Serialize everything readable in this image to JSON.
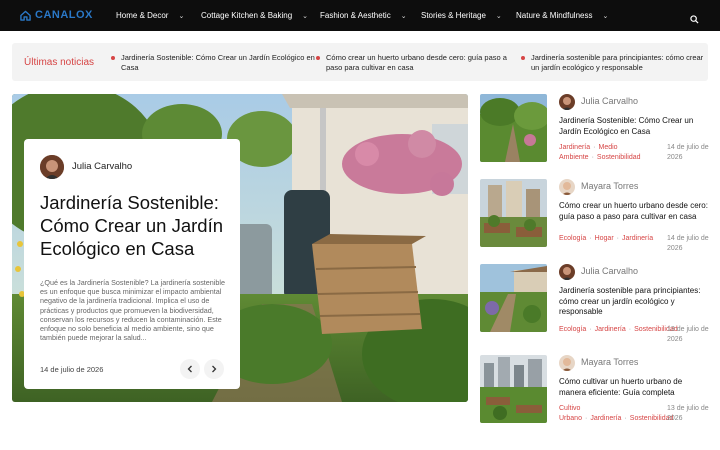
{
  "brand": {
    "name": "CANALOX",
    "logo_icon": "house-icon",
    "accent": "#2a78c7"
  },
  "nav": {
    "items": [
      {
        "label": "Home & Decor",
        "icon": "chevron-down-icon"
      },
      {
        "label": "Cottage Kitchen & Baking",
        "icon": "chevron-down-icon"
      },
      {
        "label": "Fashion & Aesthetic",
        "icon": "chevron-down-icon"
      },
      {
        "label": "Stories & Heritage",
        "icon": "chevron-down-icon"
      },
      {
        "label": "Nature & Mindfulness",
        "icon": "chevron-down-icon"
      }
    ],
    "search_icon": "search-icon"
  },
  "ticker": {
    "label": "Últimas noticias",
    "items": [
      "Jardinería Sostenible: Cómo Crear un Jardín Ecológico en Casa",
      "Cómo crear un huerto urbano desde cero: guía paso a paso para cultivar en casa",
      "Jardinería sostenible para principiantes: cómo crear un jardín ecológico y responsable"
    ],
    "accent": "#d64545"
  },
  "featured": {
    "author": "Julia Carvalho",
    "title": "Jardinería Sostenible: Cómo Crear un Jardín Ecológico en Casa",
    "excerpt": "¿Qué es la Jardinería Sostenible? La jardinería sostenible es un enfoque que busca minimizar el impacto ambiental negativo de la jardinería tradicional. Implica el uso de prácticas y productos que promueven la biodiversidad, conservan los recursos y reducen la contaminación. Este enfoque no solo beneficia al medio ambiente, sino que también puede mejorar la salud...",
    "date": "14 de julio de 2026",
    "prev_icon": "chevron-left-icon",
    "next_icon": "chevron-right-icon"
  },
  "posts": [
    {
      "author": "Julia Carvalho",
      "title": "Jardinería Sostenible: Cómo Crear un Jardín Ecológico en Casa",
      "tags": [
        "Jardinería",
        "Medio Ambiente",
        "Sostenibilidad"
      ],
      "date": "14 de julio de 2026"
    },
    {
      "author": "Mayara Torres",
      "title": "Cómo crear un huerto urbano desde cero: guía paso a paso para cultivar en casa",
      "tags": [
        "Ecología",
        "Hogar",
        "Jardinería"
      ],
      "date": "14 de julio de 2026"
    },
    {
      "author": "Julia Carvalho",
      "title": "Jardinería sostenible para principiantes: cómo crear un jardín ecológico y responsable",
      "tags": [
        "Ecología",
        "Jardinería",
        "Sostenibilidad"
      ],
      "date": "13 de julio de 2026"
    },
    {
      "author": "Mayara Torres",
      "title": "Cómo cultivar un huerto urbano de manera eficiente: Guía completa",
      "tags": [
        "Cultivo Urbano",
        "Jardinería",
        "Sostenibilidad"
      ],
      "date": "13 de julio de 2026"
    }
  ]
}
